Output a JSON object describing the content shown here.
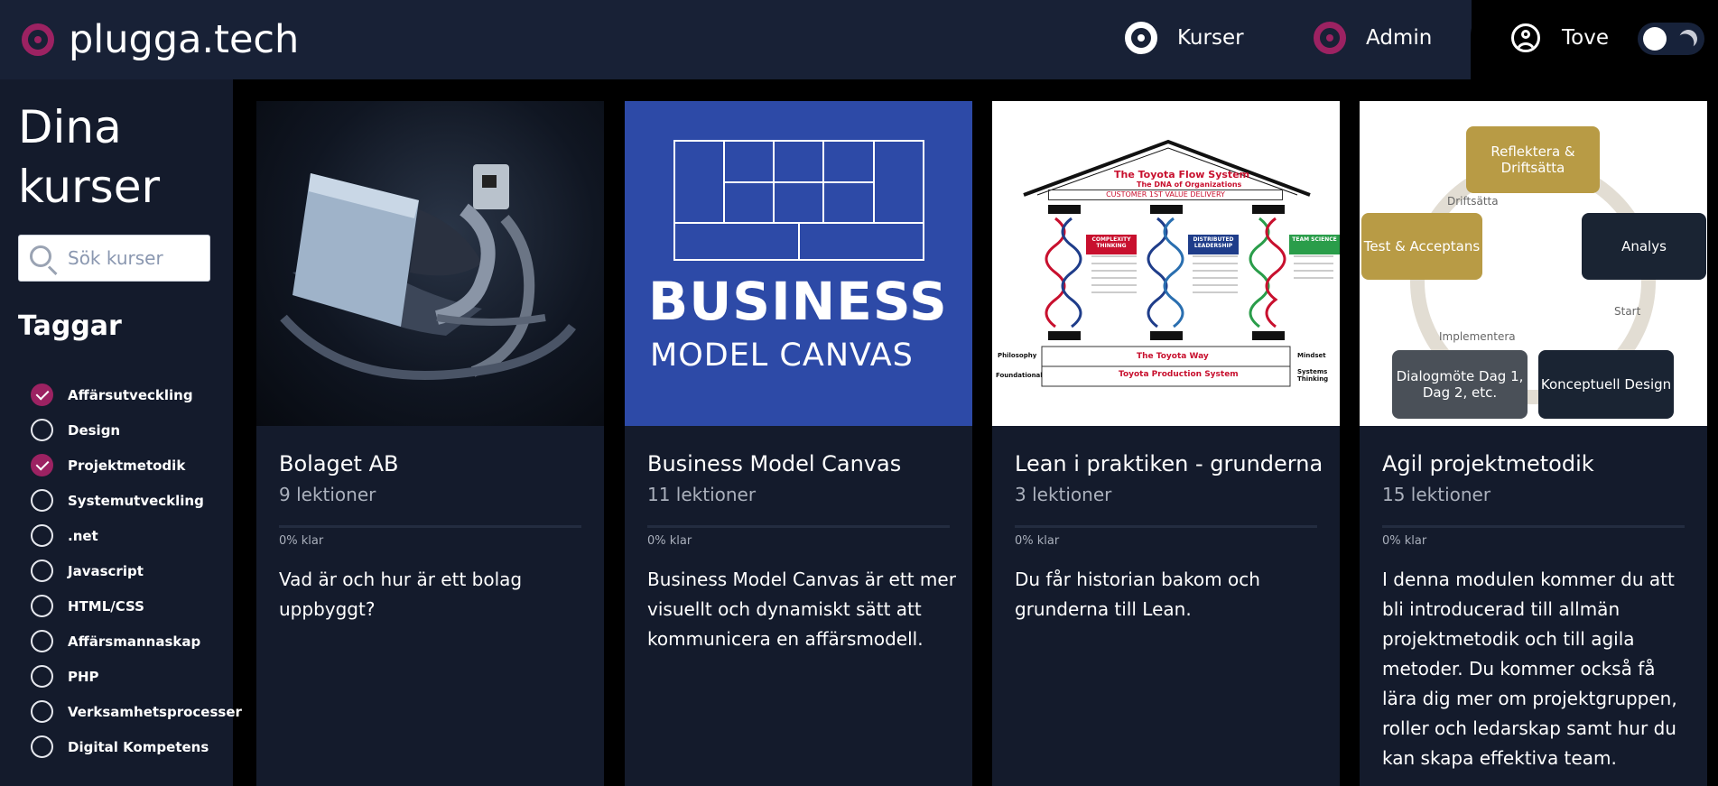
{
  "header": {
    "logo_text": "plugga.tech",
    "nav": [
      {
        "label": "Kurser",
        "icon": "target-icon"
      },
      {
        "label": "Admin",
        "icon": "target-icon"
      }
    ],
    "user_name": "Tove",
    "theme_toggle": "moon-icon"
  },
  "sidebar": {
    "title": "Dina kurser",
    "search_placeholder": "Sök kurser",
    "tags_title": "Taggar",
    "tags": [
      {
        "label": "Affärsutveckling",
        "checked": true
      },
      {
        "label": "Design",
        "checked": false
      },
      {
        "label": "Projektmetodik",
        "checked": true
      },
      {
        "label": "Systemutveckling",
        "checked": false
      },
      {
        "label": ".net",
        "checked": false
      },
      {
        "label": "Javascript",
        "checked": false
      },
      {
        "label": "HTML/CSS",
        "checked": false
      },
      {
        "label": "Affärsmannaskap",
        "checked": false
      },
      {
        "label": "PHP",
        "checked": false
      },
      {
        "label": "Verksamhetsprocesser",
        "checked": false
      },
      {
        "label": "Digital Kompetens",
        "checked": false
      }
    ]
  },
  "courses": [
    {
      "title": "Bolaget AB",
      "lessons": "9 lektioner",
      "progress_label": "0% klar",
      "progress": 0,
      "description": "Vad är och hur är ett bolag uppbyggt?"
    },
    {
      "title": "Business Model Canvas",
      "lessons": "11 lektioner",
      "progress_label": "0% klar",
      "progress": 0,
      "description": "Business Model Canvas är ett mer visuellt och dynamiskt sätt att kommunicera en affärsmodell.",
      "image_text": {
        "line1": "BUSINESS",
        "line2": "MODEL CANVAS"
      }
    },
    {
      "title": "Lean i praktiken - grunderna",
      "lessons": "3 lektioner",
      "progress_label": "0% klar",
      "progress": 0,
      "description": "Du får historian bakom och grunderna till Lean.",
      "image_text": {
        "title": "The Toyota Flow System",
        "subtitle": "The DNA of Organizations",
        "band": "CUSTOMER 1ST VALUE DELIVERY",
        "tag1": "COMPLEXITY THINKING",
        "tag2": "DISTRIBUTED LEADERSHIP",
        "tag3": "TEAM SCIENCE",
        "left1": "Philosophy",
        "left2": "Foundational",
        "right1": "Mindset",
        "right2": "Systems Thinking",
        "way": "The Toyota Way",
        "production": "Toyota Production System"
      }
    },
    {
      "title": "Agil projektmetodik",
      "lessons": "15 lektioner",
      "progress_label": "0% klar",
      "progress": 0,
      "description": "I denna modulen kommer du att bli introducerad till allmän projektmetodik och till agila metoder. Du kommer också få lära dig mer om projektgruppen, roller och ledarskap samt hur du kan skapa effektiva team.",
      "image_text": {
        "reflect": "Reflektera & Driftsätta",
        "test": "Test & Acceptans",
        "analys": "Analys",
        "dialog": "Dialogmöte Dag 1, Dag 2, etc.",
        "design": "Konceptuell Design",
        "driftsatta": "Driftsätta",
        "start": "Start",
        "implementera": "Implementera"
      }
    }
  ],
  "colors": {
    "header_bg": "#182136",
    "sidebar_bg": "#141b2c",
    "accent": "#9c2262",
    "page_bg": "#000000"
  }
}
